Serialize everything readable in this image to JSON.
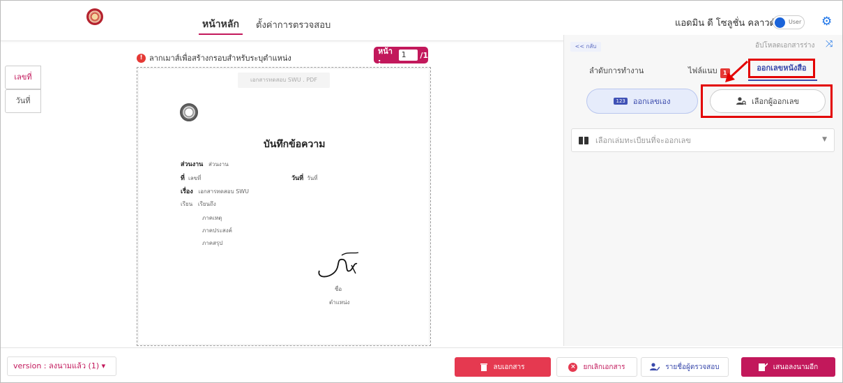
{
  "header": {
    "nav_home": "หน้าหลัก",
    "nav_settings": "ตั้งค่าการตรวจสอบ",
    "user_name": "แอดมิน ดี โซลูชั่น คลาวด์",
    "toggle_label": "User",
    "accent_color": "#c2185b",
    "gear_icon": "gear-icon"
  },
  "left_tabs": [
    {
      "label": "เลขที่",
      "active": true
    },
    {
      "label": "วันที่",
      "active": false
    }
  ],
  "editor": {
    "hint": "ลากเมาส์เพื่อสร้างกรอบสำหรับระบุตำแหน่ง",
    "page_label": "หน้า :",
    "page_value": "1",
    "page_total": "/1",
    "doc_tag": "เอกสารทดสอบ SWU . PDF"
  },
  "document": {
    "title": "บันทึกข้อความ",
    "dept_label": "ส่วนงาน",
    "dept_value": "ส่วนงาน",
    "no_label": "ที่",
    "no_value": "เลขที่",
    "date_label": "วันที่",
    "date_value": "วันที่",
    "subject_label": "เรื่อง",
    "subject_value": "เอกสารทดสอบ SWU",
    "to_label": "เรียน",
    "to_value": "เรียนถึง",
    "body1": "ภาคเหตุ",
    "body2": "ภาคประสงค์",
    "body3": "ภาคสรุป",
    "signer_name": "ชื่อ",
    "signer_position": "ตำแหน่ง"
  },
  "right_panel": {
    "back": "<< กลับ",
    "upload_draft": "อัปโหลดเอกสารร่าง",
    "tab_workflow": "ลำดับการทำงาน",
    "tab_attach": "ไฟล์แนบ",
    "attach_count": "1",
    "tab_issue_number": "ออกเลขหนังสือ",
    "seg_self": "ออกเลขเอง",
    "seg_self_icon_text": "123",
    "seg_pick": "เลือกผู้ออกเลข",
    "book_placeholder": "เลือกเล่มทะเบียนที่จะออกเลข"
  },
  "footer": {
    "version": "version : ลงนามแล้ว (1) ▾",
    "delete": "ลบเอกสาร",
    "cancel": "ยกเลิกเอกสาร",
    "reviewers": "รายชื่อผู้ตรวจสอบ",
    "send_sign": "เสนอลงนามอีก"
  }
}
